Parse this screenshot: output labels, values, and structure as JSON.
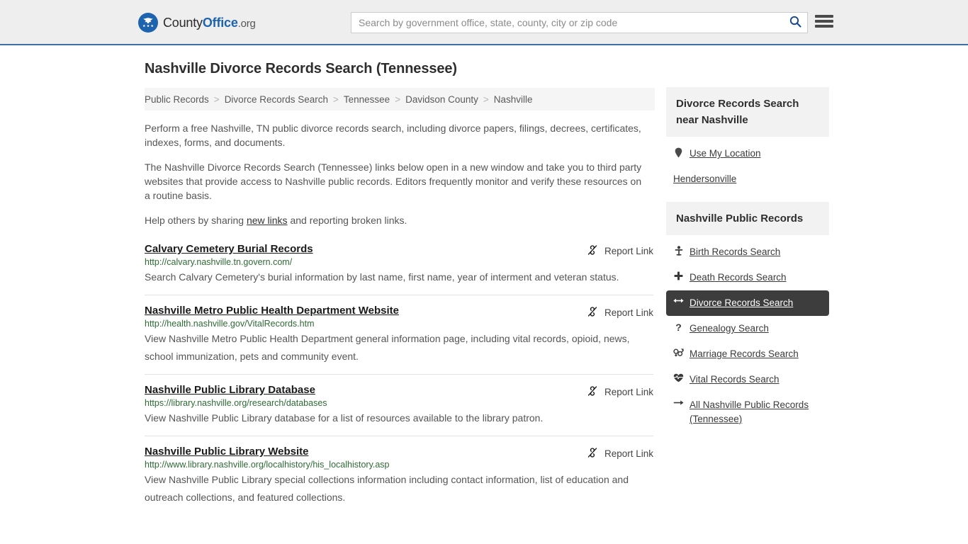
{
  "header": {
    "brand": {
      "part1": "County",
      "part2": "Office",
      "part3": ".org",
      "logo_icon": "eagle-seal-icon"
    },
    "search": {
      "placeholder": "Search by government office, state, county, city or zip code",
      "value": "",
      "button_icon": "search-icon"
    },
    "menu_icon": "hamburger-menu-icon",
    "accent_color": "#3a6ea5"
  },
  "main": {
    "title": "Nashville Divorce Records Search (Tennessee)",
    "breadcrumb": [
      "Public Records",
      "Divorce Records Search",
      "Tennessee",
      "Davidson County",
      "Nashville"
    ],
    "breadcrumb_separator": ">",
    "intro": {
      "p1": "Perform a free Nashville, TN public divorce records search, including divorce papers, filings, decrees, certificates, indexes, forms, and documents.",
      "p2": "The Nashville Divorce Records Search (Tennessee) links below open in a new window and take you to third party websites that provide access to Nashville public records. Editors frequently monitor and verify these resources on a routine basis.",
      "p3_before": "Help others by sharing ",
      "p3_link": "new links",
      "p3_after": " and reporting broken links."
    },
    "report_link_label": "Report Link",
    "report_link_icon": "broken-link-icon",
    "results": [
      {
        "title": "Calvary Cemetery Burial Records",
        "url": "http://calvary.nashville.tn.govern.com/",
        "description": "Search Calvary Cemetery's burial information by last name, first name, year of interment and veteran status."
      },
      {
        "title": "Nashville Metro Public Health Department Website",
        "url": "http://health.nashville.gov/VitalRecords.htm",
        "description": "View Nashville Metro Public Health Department general information page, including vital records, opioid, news, school immunization, pets and community event."
      },
      {
        "title": "Nashville Public Library Database",
        "url": "https://library.nashville.org/research/databases",
        "description": "View Nashville Public Library database for a list of resources available to the library patron."
      },
      {
        "title": "Nashville Public Library Website",
        "url": "http://www.library.nashville.org/localhistory/his_localhistory.asp",
        "description": "View Nashville Public Library special collections information including contact information, list of education and outreach collections, and featured collections."
      }
    ]
  },
  "sidebar": {
    "nearby": {
      "header": "Divorce Records Search near Nashville",
      "items": [
        {
          "label": "Use My Location",
          "icon": "map-pin-icon"
        },
        {
          "label": "Hendersonville",
          "icon": "none"
        }
      ]
    },
    "public_records": {
      "header": "Nashville Public Records",
      "active_color": "#3d3d3d",
      "items": [
        {
          "label": "Birth Records Search",
          "icon": "baby-icon",
          "active": false
        },
        {
          "label": "Death Records Search",
          "icon": "cross-icon",
          "active": false
        },
        {
          "label": "Divorce Records Search",
          "icon": "arrows-left-right-icon",
          "active": true
        },
        {
          "label": "Genealogy Search",
          "icon": "question-mark-icon",
          "active": false
        },
        {
          "label": "Marriage Records Search",
          "icon": "venus-mars-icon",
          "active": false
        },
        {
          "label": "Vital Records Search",
          "icon": "heartbeat-icon",
          "active": false
        },
        {
          "label": "All Nashville Public Records (Tennessee)",
          "icon": "arrow-right-icon",
          "active": false
        }
      ]
    }
  }
}
